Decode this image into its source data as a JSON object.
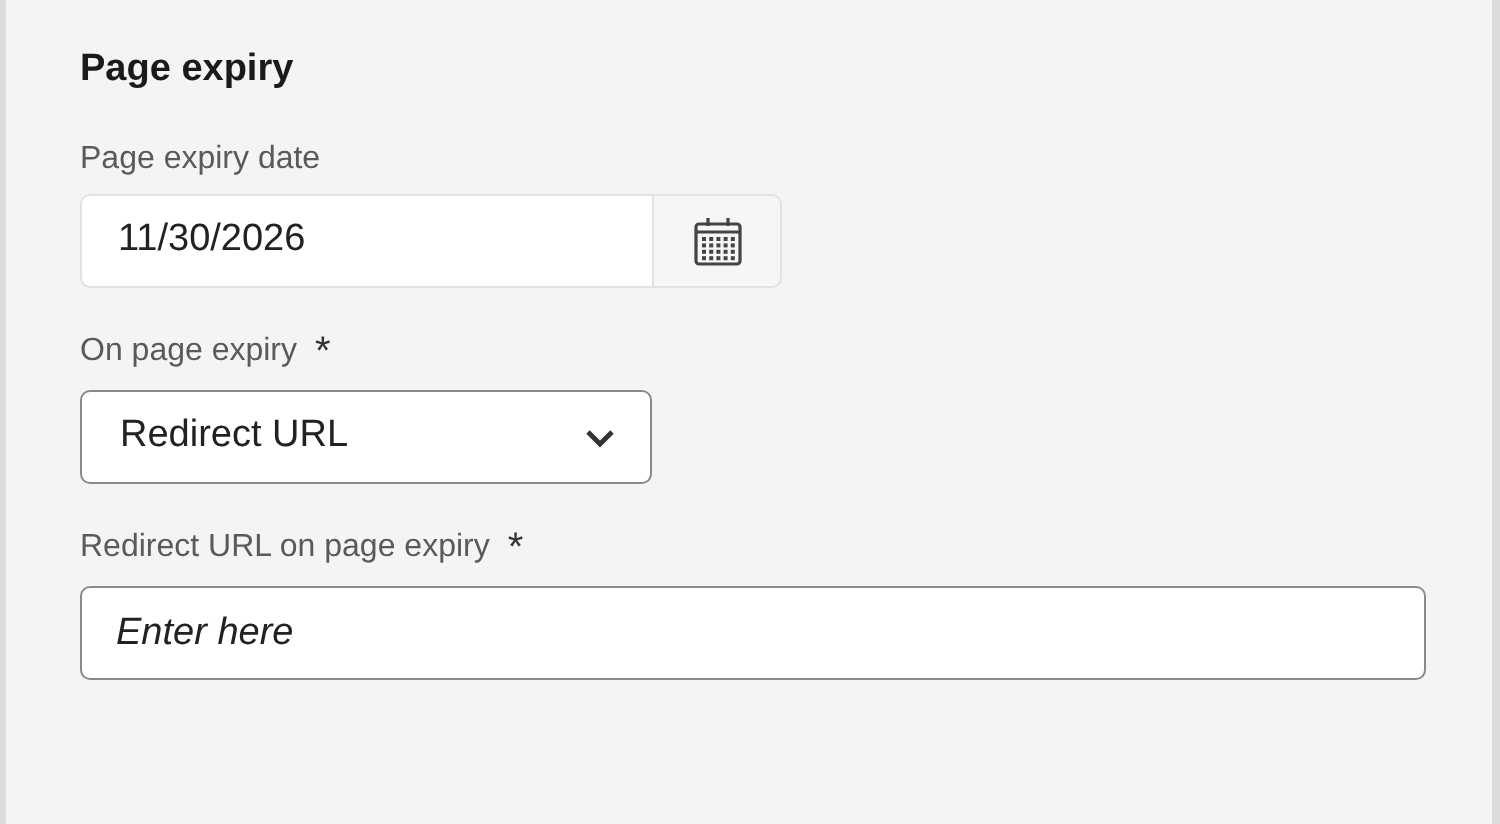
{
  "section": {
    "title": "Page expiry"
  },
  "expiry_date": {
    "label": "Page expiry date",
    "value": "11/30/2026"
  },
  "on_expiry": {
    "label": "On page expiry",
    "required_mark": "*",
    "value": "Redirect URL"
  },
  "redirect_url": {
    "label": "Redirect URL on page expiry",
    "required_mark": "*",
    "placeholder": "Enter here"
  }
}
